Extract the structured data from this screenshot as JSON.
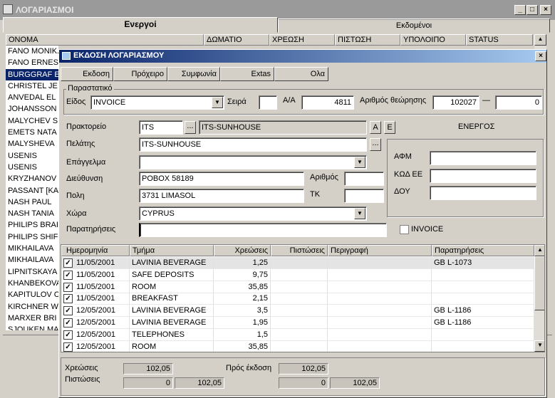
{
  "window": {
    "title": "ΛΟΓΑΡΙΑΣΜΟΙ",
    "min": "_",
    "max": "□",
    "close": "×"
  },
  "tabs": [
    {
      "label": "Ενεργοί"
    },
    {
      "label": "Εκδομένοι"
    }
  ],
  "main_grid": {
    "columns": [
      "ΟΝΟΜΑ",
      "ΔΩΜΑΤΙΟ",
      "ΧΡΕΩΣΗ",
      "ΠΙΣΤΩΣΗ",
      "ΥΠΟΛΟΙΠΟ",
      "STATUS"
    ],
    "names": [
      "FANO MONIK.",
      "FANO ERNES",
      "BURGGRAF E",
      "CHRISTEL JE",
      "ANVEDAL EL",
      "JOHANSSON",
      "MALYCHEV S",
      "EMETS NATA",
      "MALYSHEVA",
      "USENIS",
      "USENIS",
      "KRYZHANOV",
      "PASSANT [KA",
      "NASH PAUL",
      "NASH TANIA",
      "PHILIPS BRAI",
      "PHILIPS SHIF",
      "MIKHAILAVA",
      "MIKHAILAVA",
      "LIPNITSKAYA",
      "KHANBEKOVA",
      "KAPITULOV C",
      "KIRCHNER W",
      "MARXER BRI",
      "SJOUKEN MA"
    ],
    "selected_index": 2
  },
  "dialog": {
    "title": "ΕΚΔΟΣΗ ΛΟΓΑΡΙΑΣΜΟΥ",
    "close": "×",
    "toolbar": [
      "Εκδοση",
      "Πρόχειρο",
      "Συμφωνία",
      "Extas",
      "Ολα"
    ],
    "parastatiko": {
      "group_label": "Παραστατικό",
      "eidos_label": "Είδος",
      "eidos_value": "INVOICE",
      "seira_label": "Σειρά",
      "seira_value": "",
      "aa_label": "Α/Α",
      "aa_value": "4811",
      "thorisi_label": "Αριθμός θεώρησης",
      "thorisi_value": "102027",
      "dash": "—",
      "thorisi_value2": "0"
    },
    "form": {
      "praktoreio_label": "Πρακτορείο",
      "praktoreio_code": "ITS",
      "praktoreio_name": "ITS-SUNHOUSE",
      "btn_dots": "...",
      "btn_a": "A",
      "btn_e": "E",
      "status": "ΕΝΕΡΓΟΣ",
      "pelatis_label": "Πελάτης",
      "pelatis_value": "ITS-SUNHOUSE",
      "epaggelma_label": "Επάγγελμα",
      "epaggelma_value": "",
      "dieuthynsi_label": "Διεύθυνση",
      "dieuthynsi_value": "POBOX 58189",
      "arithmos_label": "Αριθμός",
      "arithmos_value": "",
      "poli_label": "Πολη",
      "poli_value": "3731 LIMASOL",
      "tk_label": "ΤΚ",
      "tk_value": "",
      "xora_label": "Χώρα",
      "xora_value": "CYPRUS",
      "paratiriseis_label": "Παρατηρήσεις",
      "paratiriseis_value": "",
      "afm_label": "ΑΦΜ",
      "kod_ee_label": "ΚΩΔ ΕΕ",
      "doy_label": "ΔΟΥ",
      "invoice_chk_label": "INVOICE"
    },
    "lines": {
      "columns": [
        "Ημερομηνία",
        "Τμήμα",
        "Χρεώσεις",
        "Πιστώσεις",
        "Περιγραφή",
        "Παρατηρήσεις"
      ],
      "rows": [
        {
          "date": "11/05/2001",
          "dept": "LAVINIA BEVERAGE",
          "debit": "1,25",
          "credit": "",
          "desc": "",
          "notes": "GB L-1073",
          "checked": true,
          "selected": true
        },
        {
          "date": "11/05/2001",
          "dept": "SAFE DEPOSITS",
          "debit": "9,75",
          "credit": "",
          "desc": "",
          "notes": "",
          "checked": true,
          "selected": false
        },
        {
          "date": "11/05/2001",
          "dept": "ROOM",
          "debit": "35,85",
          "credit": "",
          "desc": "",
          "notes": "",
          "checked": true,
          "selected": false
        },
        {
          "date": "11/05/2001",
          "dept": "BREAKFAST",
          "debit": "2,15",
          "credit": "",
          "desc": "",
          "notes": "",
          "checked": true,
          "selected": false
        },
        {
          "date": "12/05/2001",
          "dept": "LAVINIA BEVERAGE",
          "debit": "3,5",
          "credit": "",
          "desc": "",
          "notes": "GB L-1186",
          "checked": true,
          "selected": false
        },
        {
          "date": "12/05/2001",
          "dept": "LAVINIA BEVERAGE",
          "debit": "1,95",
          "credit": "",
          "desc": "",
          "notes": "GB L-1186",
          "checked": true,
          "selected": false
        },
        {
          "date": "12/05/2001",
          "dept": "TELEPHONES",
          "debit": "1,5",
          "credit": "",
          "desc": "",
          "notes": "",
          "checked": true,
          "selected": false
        },
        {
          "date": "12/05/2001",
          "dept": "ROOM",
          "debit": "35,85",
          "credit": "",
          "desc": "",
          "notes": "",
          "checked": true,
          "selected": false
        }
      ]
    },
    "totals": {
      "xreoseis_label": "Χρεώσεις",
      "xreoseis_value": "102,05",
      "pistoseis_label": "Πιστώσεις",
      "pistoseis_a": "0",
      "pistoseis_b": "102,05",
      "pros_ekdosi_label": "Πρός έκδοση",
      "pros_ekdosi_value": "102,05",
      "pros_pist_a": "0",
      "pros_pist_b": "102,05"
    }
  }
}
